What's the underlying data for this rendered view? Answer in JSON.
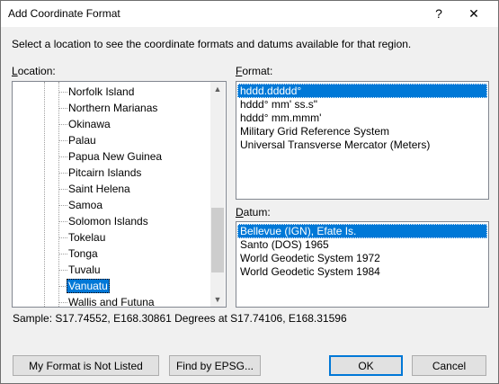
{
  "window": {
    "title": "Add Coordinate Format",
    "help_glyph": "?",
    "close_glyph": "✕"
  },
  "instructions": "Select a location to see the coordinate formats and datums available for that region.",
  "location": {
    "label": "Location:",
    "label_underline": "L",
    "label_rest": "ocation:",
    "items": [
      "Norfolk Island",
      "Northern Marianas",
      "Okinawa",
      "Palau",
      "Papua New Guinea",
      "Pitcairn Islands",
      "Saint Helena",
      "Samoa",
      "Solomon Islands",
      "Tokelau",
      "Tonga",
      "Tuvalu",
      "Vanuatu",
      "Wallis and Futuna"
    ],
    "selected": "Vanuatu"
  },
  "format": {
    "label_underline": "F",
    "label_rest": "ormat:",
    "items": [
      "hddd.ddddd°",
      "hddd° mm' ss.s\"",
      "hddd° mm.mmm'",
      "Military Grid Reference System",
      "Universal Transverse Mercator (Meters)"
    ],
    "selected": "hddd.ddddd°"
  },
  "datum": {
    "label_underline": "D",
    "label_rest": "atum:",
    "items": [
      "Bellevue (IGN), Efate Is.",
      "Santo (DOS) 1965",
      "World Geodetic System 1972",
      "World Geodetic System 1984"
    ],
    "selected": "Bellevue (IGN), Efate Is."
  },
  "sample": "Sample: S17.74552, E168.30861 Degrees at S17.74106, E168.31596",
  "buttons": {
    "not_listed": "My Format is Not Listed",
    "find_epsg": "Find by EPSG...",
    "ok": "OK",
    "cancel": "Cancel"
  },
  "colors": {
    "selection": "#0078d7",
    "dialog_bg": "#f0f0f0"
  }
}
